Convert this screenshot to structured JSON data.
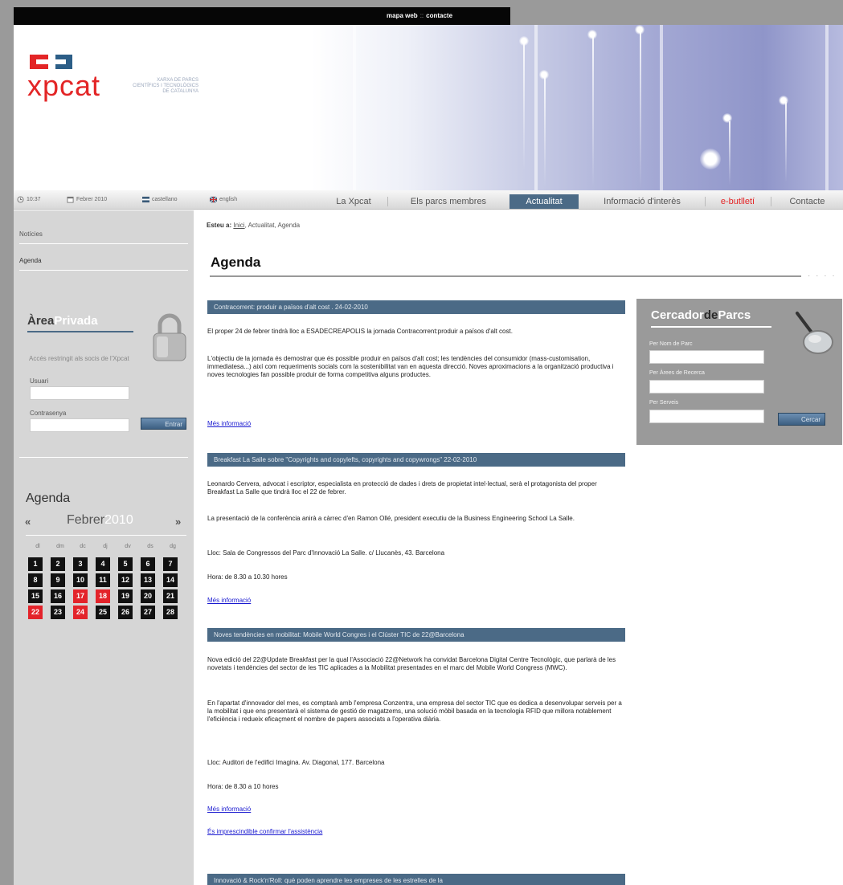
{
  "top": {
    "links": [
      "mapa web",
      "contacte"
    ],
    "separator": "::"
  },
  "logo": {
    "text": "xpcat",
    "tagline": [
      "XARXA DE PARCS",
      "CIENTÍFICS I TECNOLÒGICS",
      "DE CATALUNYA"
    ]
  },
  "navbar": {
    "time": "10:37",
    "date": "Febrer 2010",
    "lang_es": "castellano",
    "lang_en": "english",
    "items": [
      {
        "label": "La Xpcat"
      },
      {
        "label": "Els parcs membres"
      },
      {
        "label": "Actualitat",
        "active": true
      },
      {
        "label": "Informació d'interès"
      },
      {
        "label": "e-butlletí",
        "highlight": "#e32526"
      },
      {
        "label": "Contacte"
      }
    ]
  },
  "sidebar": {
    "nav": [
      "Notícies",
      "Agenda"
    ],
    "area": {
      "title_a": "Àrea",
      "title_b": "Privada",
      "text": "Accés restringit als socis de l'Xpcat",
      "user_label": "Usuari",
      "pass_label": "Contrasenya",
      "button": "Entrar"
    },
    "calendar": {
      "title": "Agenda",
      "prev": "«",
      "next": "»",
      "month": "Febrer",
      "year": "2010",
      "weekdays": [
        "dl",
        "dm",
        "dc",
        "dj",
        "dv",
        "ds",
        "dg"
      ],
      "days": [
        "1",
        "2",
        "3",
        "4",
        "5",
        "6",
        "7",
        "8",
        "9",
        "10",
        "11",
        "12",
        "13",
        "14",
        "15",
        "16",
        "17",
        "18",
        "19",
        "20",
        "21",
        "22",
        "23",
        "24",
        "25",
        "26",
        "27",
        "28"
      ],
      "red_days": [
        "17",
        "18",
        "22",
        "24"
      ]
    }
  },
  "main": {
    "crumb_label": "Esteu a:",
    "crumb_home": "Inici",
    "crumb_rest": ", Actualitat, Agenda",
    "title": "Agenda",
    "title_dots": "· · · ·",
    "events": [
      {
        "title": "Contracorrent: produir a països d'alt cost . 24-02-2010",
        "paras": [
          "El proper 24 de febrer tindrà lloc a ESADECREAPOLIS la jornada Contracorrent:produir a països d'alt cost.",
          "L'objectiu de la jornada és demostrar que és possible produir en països d'alt cost; les tendències del consumidor (mass-customisation, immediatesa...) així com requeriments socials com la sostenibilitat van en aquesta direcció. Noves aproximacions a la organització productiva i noves tecnologies fan possible produir de forma competitiva alguns productes."
        ],
        "links": [
          "Més informació"
        ]
      },
      {
        "title": "Breakfast La Salle sobre \"Copyrights and copylefts, copyrights and copywrongs\" 22-02-2010",
        "paras": [
          "Leonardo Cervera, advocat i escriptor, especialista en protecció de dades i drets de propietat intel·lectual, serà el protagonista del proper Breakfast La Salle que tindrà lloc el 22 de febrer.",
          "La presentació de la conferència anirà a càrrec d'en Ramon Ollé, president executiu de la Business Engineering School La Salle.",
          "Lloc: Sala de Congressos del Parc d'Innovació La Salle. c/ Llucanès, 43. Barcelona",
          "Hora: de 8.30 a 10.30 hores"
        ],
        "links": [
          "Més informació"
        ]
      },
      {
        "title": "Noves tendències en mobilitat: Mobile World Congres i el Clúster TIC de 22@Barcelona",
        "paras": [
          "Nova edició del 22@Update Breakfast per la qual l'Associació 22@Network ha convidat Barcelona Digital Centre Tecnològic, que parlarà de les novetats i tendències del sector de les TIC aplicades a la Mobilitat presentades en el marc del Mobile World Congress (MWC).",
          "En l'apartat d'innovador del mes, es comptarà amb l'empresa Conzentra, una empresa del sector TIC que es dedica a desenvolupar serveis per a la mobilitat i que ens presentarà el sistema de gestió de magatzems, una solució mòbil basada en la tecnologia RFID que millora notablement l'eficiència i redueix eficaçment el nombre de papers associats a l'operativa diària.",
          "Lloc: Auditori de l'edifici Imagina. Av. Diagonal, 177. Barcelona",
          "Hora: de 8.30 a 10 hores"
        ],
        "links": [
          "Més informació",
          "És imprescindible confirmar l'assistència"
        ]
      },
      {
        "title": "Innovació & Rock'n'Roll: què poden aprendre les empreses de les estrelles de la",
        "paras": [],
        "links": []
      }
    ]
  },
  "finder": {
    "title_a": "Cercador",
    "title_b": "de",
    "title_c": "Parcs",
    "fields": [
      "Per Nom de Parc",
      "Per Àrees de Recerca",
      "Per Serveis"
    ],
    "button": "Cercar"
  }
}
